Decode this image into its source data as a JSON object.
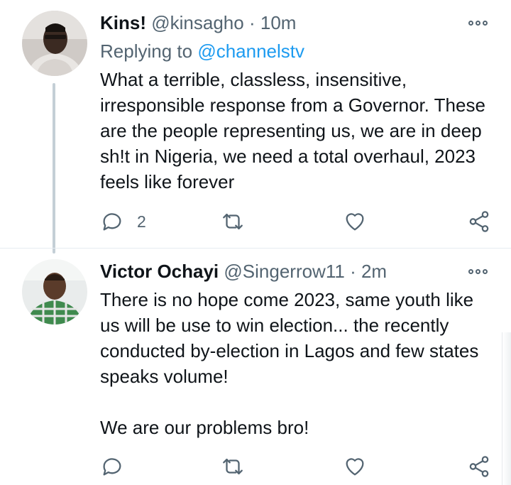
{
  "colors": {
    "text": "#0f1419",
    "muted": "#536471",
    "link": "#1d9bf0",
    "thread_line": "#c4cfd6"
  },
  "tweets": [
    {
      "name": "Kins!",
      "handle": "@kinsagho",
      "separator": "·",
      "time": "10m",
      "reply_prefix": "Replying to ",
      "reply_to": "@channelstv",
      "text": "What a terrible, classless, insensitive, irresponsible response from a Governor. These are the people representing us, we are in deep sh!t in Nigeria, we need a total overhaul, 2023 feels like forever",
      "reply_count": "2",
      "icons": {
        "more": "more-icon",
        "reply": "reply-icon",
        "retweet": "retweet-icon",
        "like": "heart-icon",
        "share": "share-icon"
      }
    },
    {
      "name": "Victor Ochayi",
      "handle": "@Singerrow11",
      "separator": "·",
      "time": "2m",
      "text": "There is no hope come 2023, same youth like us will be use to win election... the recently conducted by-election in Lagos and few states speaks volume!\n\nWe are our problems bro!",
      "icons": {
        "more": "more-icon",
        "reply": "reply-icon",
        "retweet": "retweet-icon",
        "like": "heart-icon",
        "share": "share-icon"
      }
    }
  ]
}
